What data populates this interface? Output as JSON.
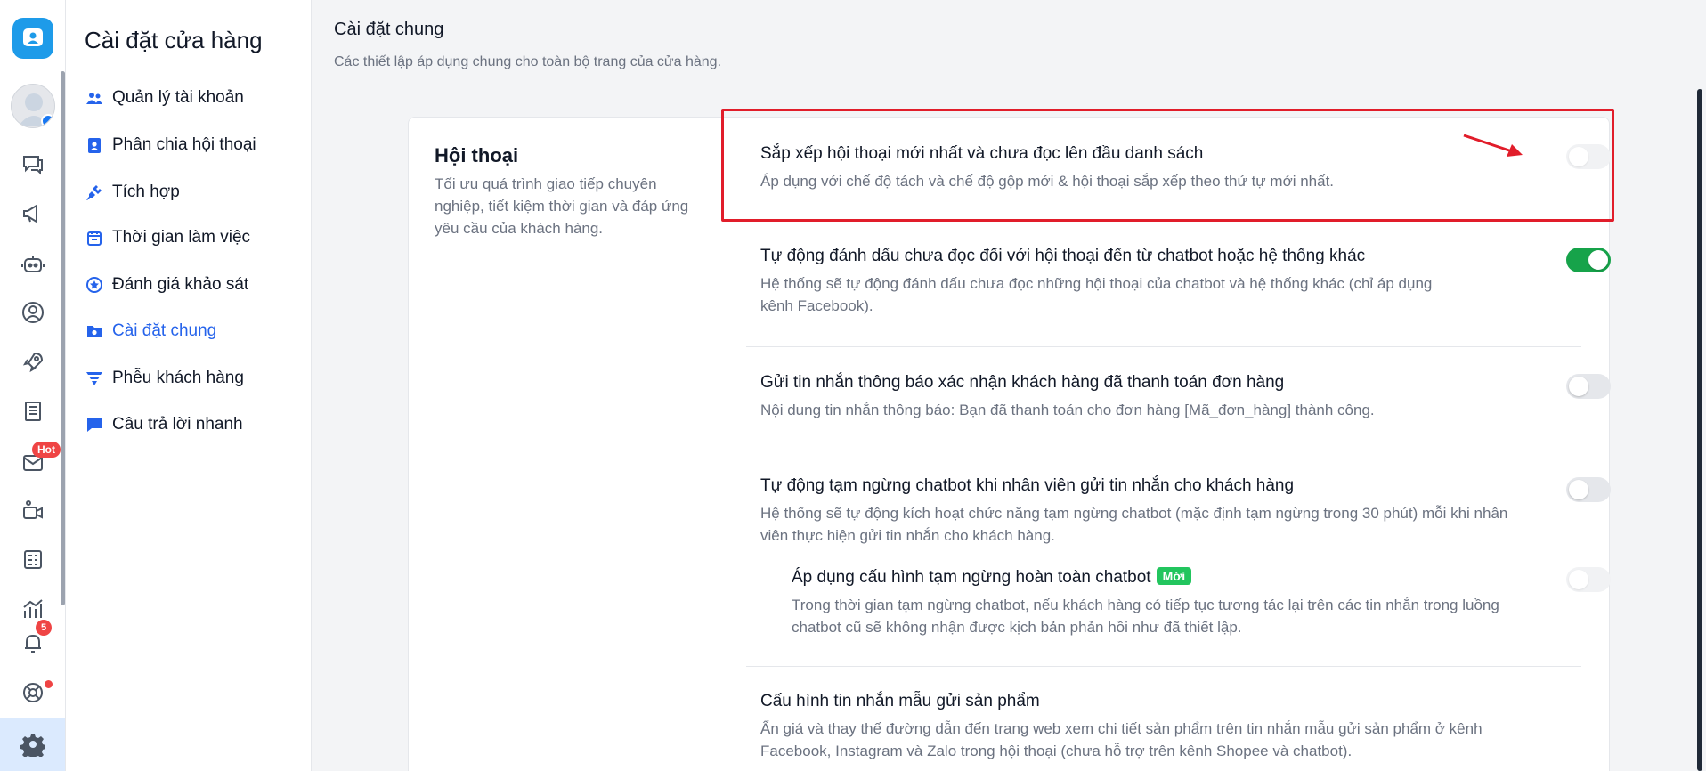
{
  "sidebar": {
    "title": "Cài đặt cửa hàng",
    "items": [
      {
        "label": "Quản lý tài khoản",
        "icon": "users-icon"
      },
      {
        "label": "Phân chia hội thoại",
        "icon": "contact-card-icon"
      },
      {
        "label": "Tích hợp",
        "icon": "plug-icon"
      },
      {
        "label": "Thời gian làm việc",
        "icon": "calendar-icon"
      },
      {
        "label": "Đánh giá khảo sát",
        "icon": "star-badge-icon"
      },
      {
        "label": "Cài đặt chung",
        "icon": "settings-folder-icon",
        "active": true
      },
      {
        "label": "Phễu khách hàng",
        "icon": "funnel-icon"
      },
      {
        "label": "Câu trả lời nhanh",
        "icon": "chat-bubble-icon"
      }
    ]
  },
  "rail": {
    "hot_badge": "Hot",
    "notification_count": "5"
  },
  "page": {
    "title": "Cài đặt chung",
    "subtitle": "Các thiết lập áp dụng chung cho toàn bộ trang của cửa hàng."
  },
  "section": {
    "title": "Hội thoại",
    "description": "Tối ưu quá trình giao tiếp chuyên nghiệp, tiết kiệm thời gian và đáp ứng yêu cầu của khách hàng."
  },
  "settings": [
    {
      "title": "Sắp xếp hội thoại mới nhất và chưa đọc lên đầu danh sách",
      "desc": "Áp dụng với chế độ tách và chế độ gộp mới & hội thoại sắp xếp theo thứ tự mới nhất.",
      "enabled": false
    },
    {
      "title": "Tự động đánh dấu chưa đọc đối với hội thoại đến từ chatbot hoặc hệ thống khác",
      "desc": "Hệ thống sẽ tự động đánh dấu chưa đọc những hội thoại của chatbot và hệ thống khác (chỉ áp dụng kênh Facebook).",
      "enabled": true
    },
    {
      "title": "Gửi tin nhắn thông báo xác nhận khách hàng đã thanh toán đơn hàng",
      "desc": "Nội dung tin nhắn thông báo: Bạn đã thanh toán cho đơn hàng [Mã_đơn_hàng] thành công.",
      "enabled": false
    },
    {
      "title": "Tự động tạm ngừng chatbot khi nhân viên gửi tin nhắn cho khách hàng",
      "desc": "Hệ thống sẽ tự động kích hoạt chức năng tạm ngừng chatbot (mặc định tạm ngừng trong 30 phút) mỗi khi nhân viên thực hiện gửi tin nhắn cho khách hàng.",
      "enabled": false
    },
    {
      "title": "Áp dụng cấu hình tạm ngừng hoàn toàn chatbot",
      "badge": "Mới",
      "desc": "Trong thời gian tạm ngừng chatbot, nếu khách hàng có tiếp tục tương tác lại trên các tin nhắn trong luồng chatbot cũ sẽ không nhận được kịch bản phản hồi như đã thiết lập.",
      "enabled": false
    },
    {
      "title": "Cấu hình tin nhắn mẫu gửi sản phẩm",
      "desc": "Ẩn giá và thay thế đường dẫn đến trang web xem chi tiết sản phẩm trên tin nhắn mẫu gửi sản phẩm ở kênh Facebook, Instagram và Zalo trong hội thoại (chưa hỗ trợ trên kênh Shopee và chatbot)."
    }
  ],
  "colors": {
    "accent": "#2563eb",
    "toggle_on": "#16a34a",
    "highlight": "#e11d2a",
    "badge_new": "#22c55e"
  }
}
